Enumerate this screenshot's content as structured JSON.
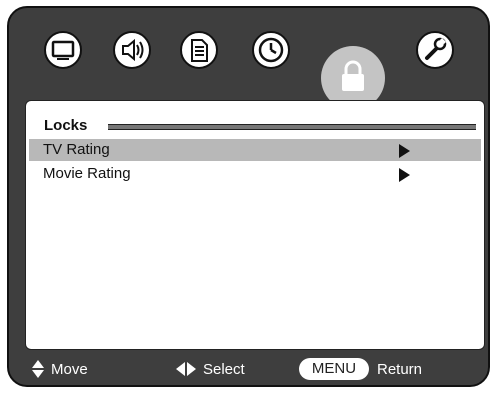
{
  "tabs": [
    {
      "icon": "picture-icon"
    },
    {
      "icon": "audio-icon"
    },
    {
      "icon": "setup-icon"
    },
    {
      "icon": "clock-icon"
    },
    {
      "icon": "lock-icon",
      "selected": true
    },
    {
      "icon": "wrench-icon"
    }
  ],
  "section": {
    "title": "Locks"
  },
  "menu_items": [
    {
      "label": "TV Rating",
      "selected": true
    },
    {
      "label": "Movie Rating",
      "selected": false
    }
  ],
  "footer": {
    "move_label": "Move",
    "select_label": "Select",
    "menu_key": "MENU",
    "return_label": "Return"
  },
  "colors": {
    "background": "#3e3e3e",
    "highlight": "#b8b8b8",
    "panel": "#ffffff"
  }
}
